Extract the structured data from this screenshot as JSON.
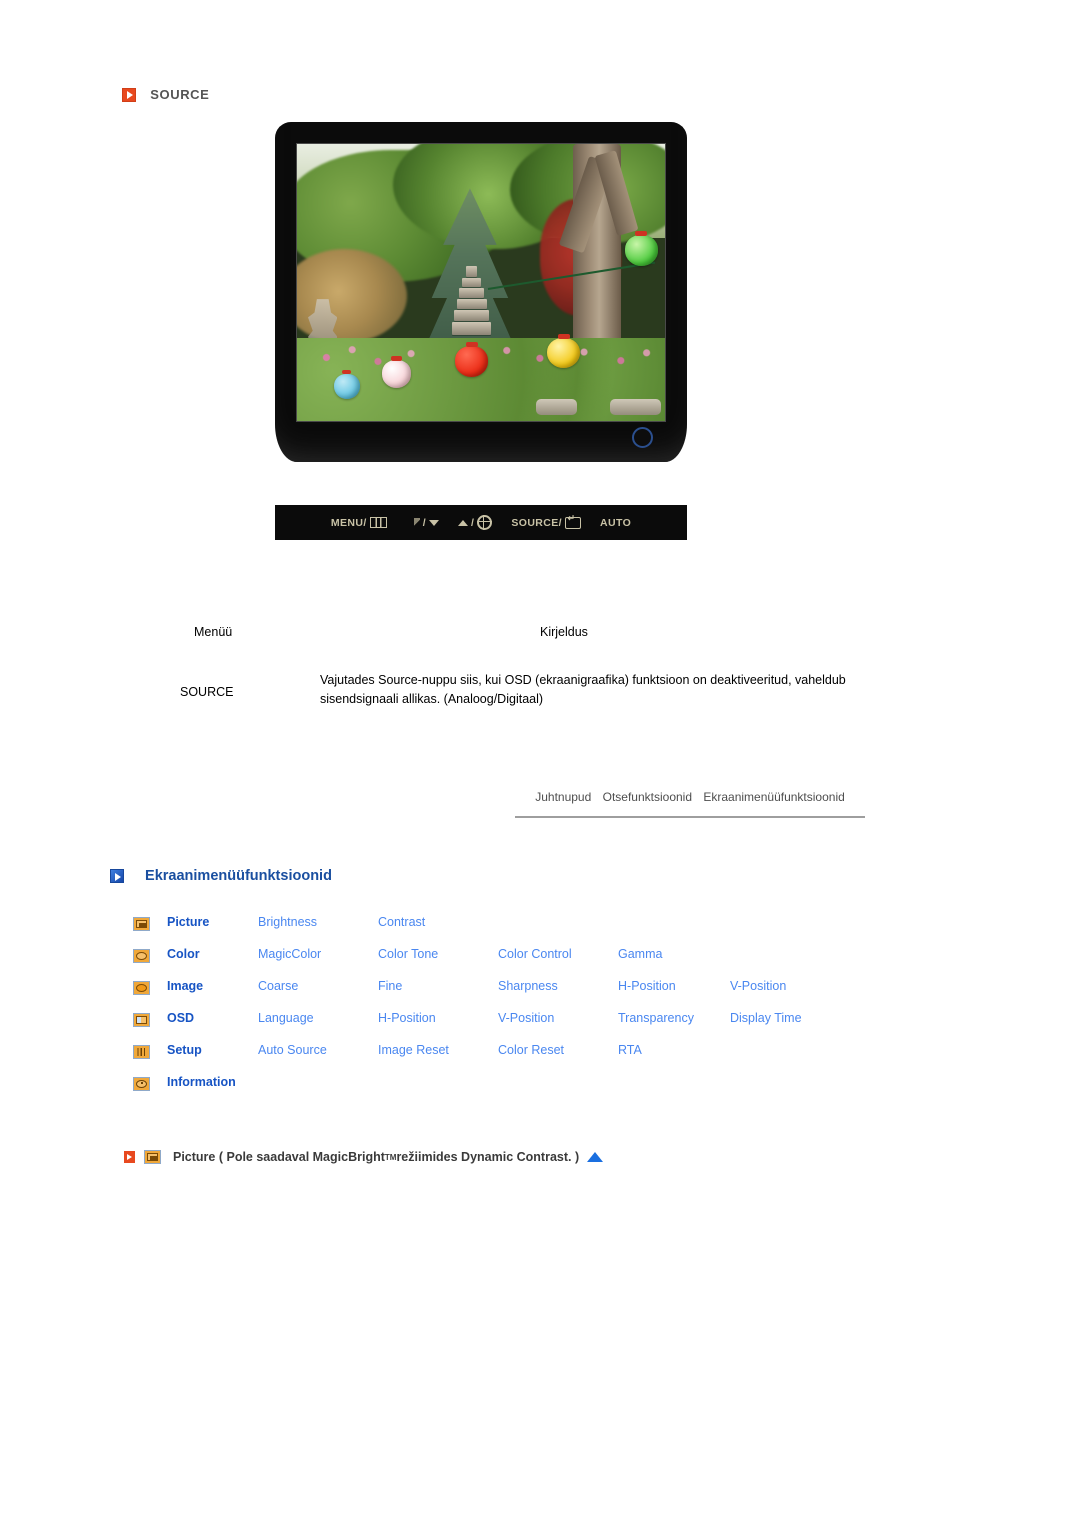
{
  "source_section": {
    "icon": "play-arrow-icon",
    "title": "SOURCE"
  },
  "monitor": {
    "alt": "lcd-monitor-front-view",
    "power_button": "power-button",
    "screen_image": "korean-garden-with-pagoda-and-paper-lanterns",
    "controls": [
      {
        "name": "menu-button",
        "label": "MENU/",
        "glyph": "menu-icon"
      },
      {
        "name": "brightness-down-button",
        "label": "",
        "glyph": "brightness-icon",
        "separator": "/",
        "glyph2": "down-arrow-icon"
      },
      {
        "name": "up-adjust-button",
        "label": "",
        "glyph": "up-arrow-icon",
        "separator": "/",
        "glyph2": "gear-icon"
      },
      {
        "name": "source-enter-button",
        "label": "SOURCE/",
        "glyph": "enter-icon"
      },
      {
        "name": "auto-button",
        "label": "AUTO",
        "glyph": ""
      }
    ]
  },
  "description_table": {
    "headers": {
      "menu": "Menüü",
      "description": "Kirjeldus"
    },
    "rows": [
      {
        "menu": "SOURCE",
        "description": "Vajutades Source-nuppu siis, kui OSD (ekraanigraafika) funktsioon on deaktiveeritud, vaheldub sisendsignaali allikas. (Analoog/Digitaal)"
      }
    ]
  },
  "nav": {
    "links": [
      "Juhtnupud",
      "Otsefunktsioonid",
      "Ekraanimenüüfunktsioonid"
    ]
  },
  "osd_section": {
    "icon": "play-arrow-icon",
    "title": "Ekraanimenüüfunktsioonid",
    "rows": [
      {
        "icon": "picture-icon",
        "label": "Picture",
        "items": [
          "Brightness",
          "Contrast"
        ]
      },
      {
        "icon": "color-icon",
        "label": "Color",
        "items": [
          "MagicColor",
          "Color Tone",
          "Color Control",
          "Gamma"
        ]
      },
      {
        "icon": "image-icon",
        "label": "Image",
        "items": [
          "Coarse",
          "Fine",
          "Sharpness",
          "H-Position",
          "V-Position"
        ]
      },
      {
        "icon": "osd-icon",
        "label": "OSD",
        "items": [
          "Language",
          "H-Position",
          "V-Position",
          "Transparency",
          "Display Time"
        ]
      },
      {
        "icon": "setup-icon",
        "label": "Setup",
        "items": [
          "Auto Source",
          "Image Reset",
          "Color Reset",
          "RTA"
        ]
      },
      {
        "icon": "information-icon",
        "label": "Information",
        "items": []
      }
    ]
  },
  "picture_line": {
    "bullet_icon": "red-play-arrow-icon",
    "menu_icon": "picture-icon",
    "text_before": "Picture ( Pole saadaval MagicBright",
    "trademark": "TM",
    "text_after": " režiimides Dynamic Contrast. )",
    "top_icon": "scroll-to-top-triangle-icon"
  },
  "colors": {
    "accent_orange": "#e8491f",
    "heading_blue": "#1a4fa0",
    "link_blue": "#4a87f0",
    "label_blue": "#1754c4",
    "icon_orange": "#f0a83a",
    "rule_gray": "#9e9e9e"
  }
}
